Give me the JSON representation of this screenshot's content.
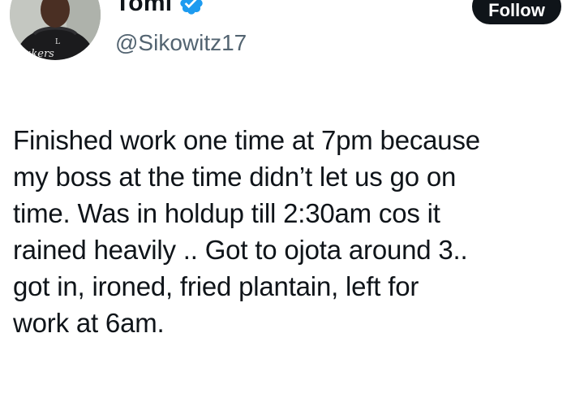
{
  "author": {
    "display_name": "Tomi",
    "handle": "@Sikowitz17",
    "verified": true,
    "verified_color": "#1d9bf0",
    "avatar_icon": "profile-photo"
  },
  "actions": {
    "follow_label": "Follow"
  },
  "tweet": {
    "text": "Finished work one time at 7pm because\nmy boss at the time didn’t let us go on\ntime. Was in holdup till 2:30am cos it\nrained heavily .. Got to ojota around 3..\ngot in, ironed, fried plantain, left for\nwork at 6am."
  },
  "colors": {
    "text": "#0f1419",
    "secondary": "#536471",
    "button_bg": "#0f1419"
  }
}
